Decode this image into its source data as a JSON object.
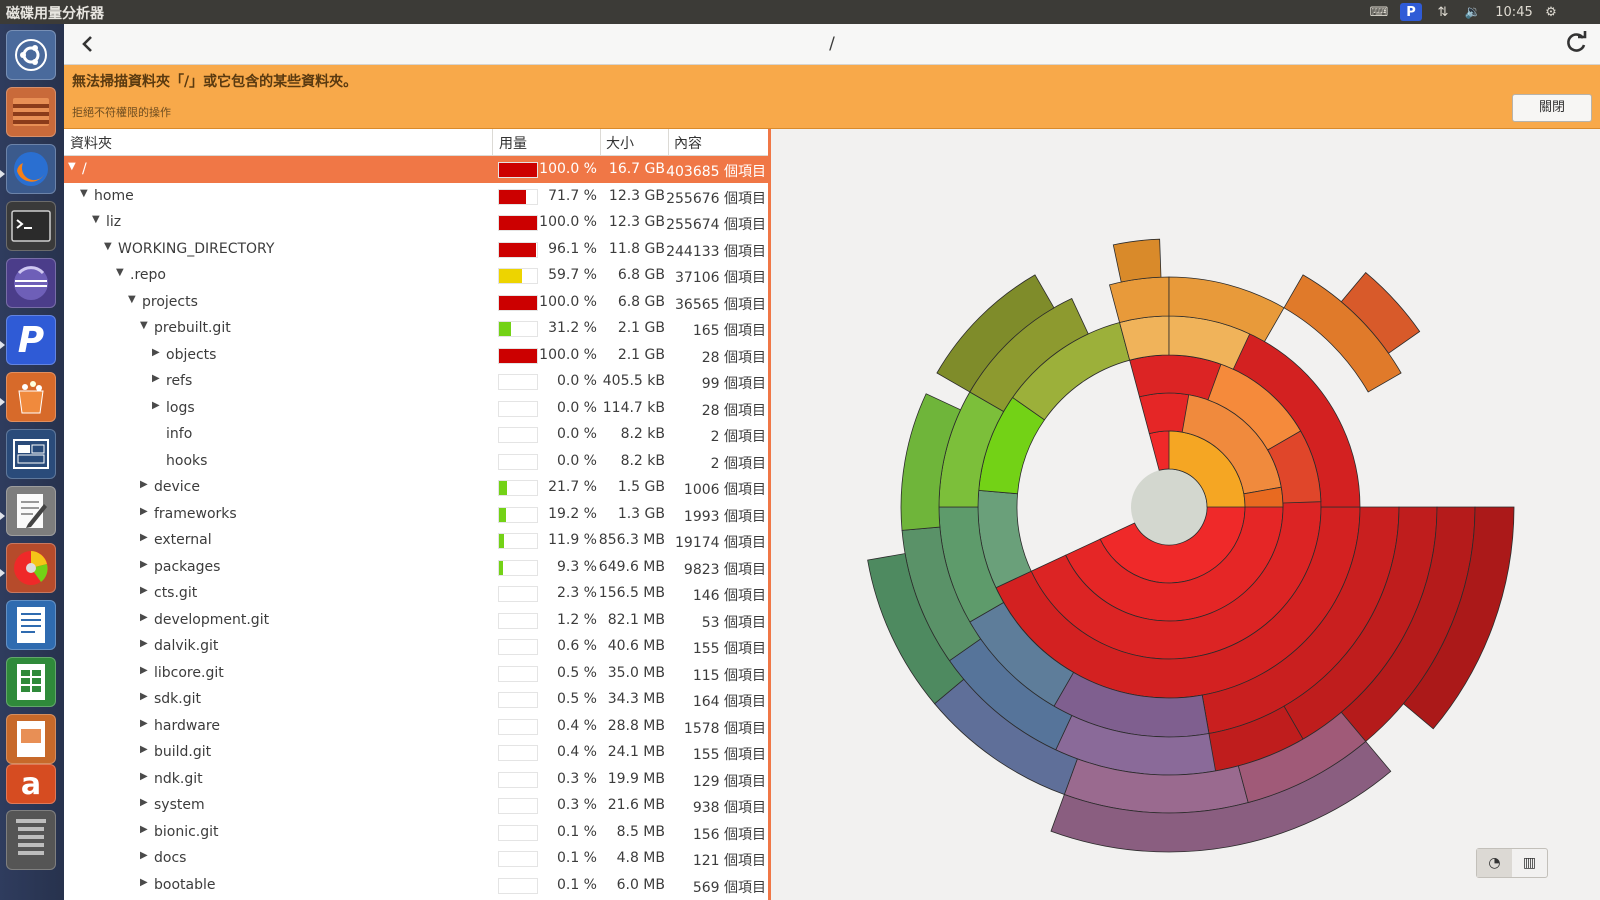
{
  "app_title": "磁碟用量分析器",
  "topbar": {
    "time": "10:45"
  },
  "toolbar": {
    "path": "/",
    "back_icon": "chevron-left-icon",
    "reload_icon": "reload-icon"
  },
  "infobar": {
    "message": "無法掃描資料夾「/」或它包含的某些資料夾。",
    "detail": "拒絕不符權限的操作",
    "close_label": "關閉"
  },
  "table": {
    "headers": {
      "folder": "資料夾",
      "usage": "用量",
      "size": "大小",
      "contents": "內容"
    },
    "rows": [
      {
        "name": "/",
        "depth": 0,
        "expander": "open",
        "pct": "100.0 %",
        "size": "16.7 GB",
        "count": "403685 個項目",
        "fill": 1.0,
        "color": "#cc0000",
        "selected": true
      },
      {
        "name": "home",
        "depth": 1,
        "expander": "open",
        "pct": "71.7 %",
        "size": "12.3 GB",
        "count": "255676 個項目",
        "fill": 0.717,
        "color": "#cc0000"
      },
      {
        "name": "liz",
        "depth": 2,
        "expander": "open",
        "pct": "100.0 %",
        "size": "12.3 GB",
        "count": "255674 個項目",
        "fill": 1.0,
        "color": "#cc0000"
      },
      {
        "name": "WORKING_DIRECTORY",
        "depth": 3,
        "expander": "open",
        "pct": "96.1 %",
        "size": "11.8 GB",
        "count": "244133 個項目",
        "fill": 0.961,
        "color": "#cc0000"
      },
      {
        "name": ".repo",
        "depth": 4,
        "expander": "open",
        "pct": "59.7 %",
        "size": "6.8 GB",
        "count": "37106 個項目",
        "fill": 0.597,
        "color": "#edd400"
      },
      {
        "name": "projects",
        "depth": 5,
        "expander": "open",
        "pct": "100.0 %",
        "size": "6.8 GB",
        "count": "36565 個項目",
        "fill": 1.0,
        "color": "#cc0000"
      },
      {
        "name": "prebuilt.git",
        "depth": 6,
        "expander": "open",
        "pct": "31.2 %",
        "size": "2.1 GB",
        "count": "165 個項目",
        "fill": 0.312,
        "color": "#73d216"
      },
      {
        "name": "objects",
        "depth": 7,
        "expander": "closed",
        "pct": "100.0 %",
        "size": "2.1 GB",
        "count": "28 個項目",
        "fill": 1.0,
        "color": "#cc0000"
      },
      {
        "name": "refs",
        "depth": 7,
        "expander": "closed",
        "pct": "0.0 %",
        "size": "405.5 kB",
        "count": "99 個項目",
        "fill": 0,
        "color": "#cc0000"
      },
      {
        "name": "logs",
        "depth": 7,
        "expander": "closed",
        "pct": "0.0 %",
        "size": "114.7 kB",
        "count": "28 個項目",
        "fill": 0,
        "color": "#cc0000"
      },
      {
        "name": "info",
        "depth": 7,
        "expander": "none",
        "pct": "0.0 %",
        "size": "8.2 kB",
        "count": "2 個項目",
        "fill": 0,
        "color": "#cc0000"
      },
      {
        "name": "hooks",
        "depth": 7,
        "expander": "none",
        "pct": "0.0 %",
        "size": "8.2 kB",
        "count": "2 個項目",
        "fill": 0,
        "color": "#cc0000"
      },
      {
        "name": "device",
        "depth": 6,
        "expander": "closed",
        "pct": "21.7 %",
        "size": "1.5 GB",
        "count": "1006 個項目",
        "fill": 0.217,
        "color": "#73d216"
      },
      {
        "name": "frameworks",
        "depth": 6,
        "expander": "closed",
        "pct": "19.2 %",
        "size": "1.3 GB",
        "count": "1993 個項目",
        "fill": 0.192,
        "color": "#73d216"
      },
      {
        "name": "external",
        "depth": 6,
        "expander": "closed",
        "pct": "11.9 %",
        "size": "856.3 MB",
        "count": "19174 個項目",
        "fill": 0.119,
        "color": "#73d216"
      },
      {
        "name": "packages",
        "depth": 6,
        "expander": "closed",
        "pct": "9.3 %",
        "size": "649.6 MB",
        "count": "9823 個項目",
        "fill": 0.093,
        "color": "#73d216"
      },
      {
        "name": "cts.git",
        "depth": 6,
        "expander": "closed",
        "pct": "2.3 %",
        "size": "156.5 MB",
        "count": "146 個項目",
        "fill": 0,
        "color": "#73d216"
      },
      {
        "name": "development.git",
        "depth": 6,
        "expander": "closed",
        "pct": "1.2 %",
        "size": "82.1 MB",
        "count": "53 個項目",
        "fill": 0,
        "color": "#73d216"
      },
      {
        "name": "dalvik.git",
        "depth": 6,
        "expander": "closed",
        "pct": "0.6 %",
        "size": "40.6 MB",
        "count": "155 個項目",
        "fill": 0,
        "color": "#73d216"
      },
      {
        "name": "libcore.git",
        "depth": 6,
        "expander": "closed",
        "pct": "0.5 %",
        "size": "35.0 MB",
        "count": "115 個項目",
        "fill": 0,
        "color": "#73d216"
      },
      {
        "name": "sdk.git",
        "depth": 6,
        "expander": "closed",
        "pct": "0.5 %",
        "size": "34.3 MB",
        "count": "164 個項目",
        "fill": 0,
        "color": "#73d216"
      },
      {
        "name": "hardware",
        "depth": 6,
        "expander": "closed",
        "pct": "0.4 %",
        "size": "28.8 MB",
        "count": "1578 個項目",
        "fill": 0,
        "color": "#73d216"
      },
      {
        "name": "build.git",
        "depth": 6,
        "expander": "closed",
        "pct": "0.4 %",
        "size": "24.1 MB",
        "count": "155 個項目",
        "fill": 0,
        "color": "#73d216"
      },
      {
        "name": "ndk.git",
        "depth": 6,
        "expander": "closed",
        "pct": "0.3 %",
        "size": "19.9 MB",
        "count": "129 個項目",
        "fill": 0,
        "color": "#73d216"
      },
      {
        "name": "system",
        "depth": 6,
        "expander": "closed",
        "pct": "0.3 %",
        "size": "21.6 MB",
        "count": "938 個項目",
        "fill": 0,
        "color": "#73d216"
      },
      {
        "name": "bionic.git",
        "depth": 6,
        "expander": "closed",
        "pct": "0.1 %",
        "size": "8.5 MB",
        "count": "156 個項目",
        "fill": 0,
        "color": "#73d216"
      },
      {
        "name": "docs",
        "depth": 6,
        "expander": "closed",
        "pct": "0.1 %",
        "size": "4.8 MB",
        "count": "121 個項目",
        "fill": 0,
        "color": "#73d216"
      },
      {
        "name": "bootable",
        "depth": 6,
        "expander": "closed",
        "pct": "0.1 %",
        "size": "6.0 MB",
        "count": "569 個項目",
        "fill": 0,
        "color": "#73d216"
      }
    ]
  },
  "chart": {
    "type": "ring-chart",
    "colors": {
      "root": "#d3d7cf",
      "red": "#ef2929",
      "orange": "#f57900",
      "green": "#73d216",
      "teal": "#5e9b6b",
      "blue": "#5e7d9a",
      "purple": "#8e6a9e"
    }
  },
  "launcher_icons": [
    "ubuntu-logo-icon",
    "files-icon",
    "firefox-icon",
    "terminal-icon",
    "eclipse-icon",
    "pidgin-icon",
    "software-center-icon",
    "workspace-icon",
    "text-editor-icon",
    "disk-usage-icon",
    "writer-icon",
    "calc-icon",
    "impress-icon",
    "amazon-icon",
    "trash-icon"
  ]
}
